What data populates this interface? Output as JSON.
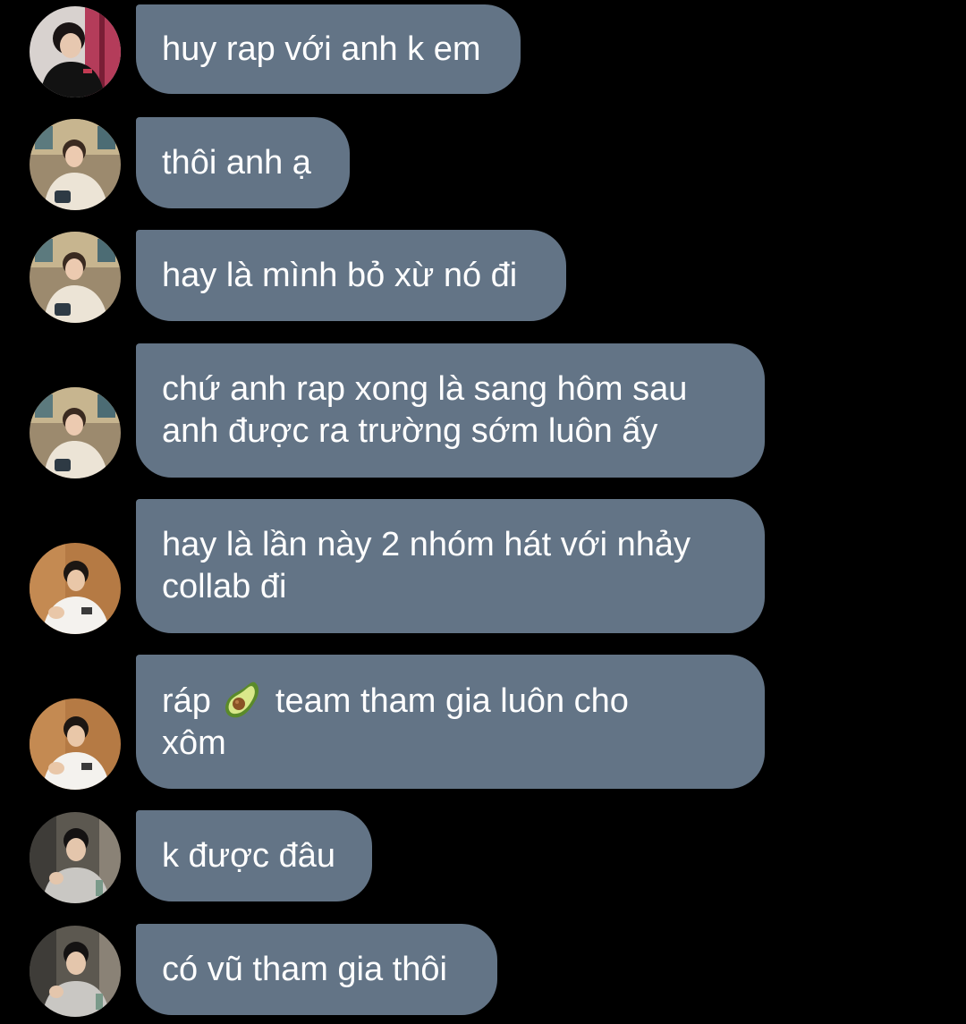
{
  "theme": {
    "background": "#000000",
    "bubble_color": "#637486",
    "text_color": "#ffffff"
  },
  "messages": [
    {
      "sender_avatar": "avatar-a",
      "text": "huy rap với anh k em"
    },
    {
      "sender_avatar": "avatar-b",
      "text": "thôi anh ạ"
    },
    {
      "sender_avatar": "avatar-b",
      "text": "hay là mình bỏ xừ nó đi"
    },
    {
      "sender_avatar": "avatar-b",
      "text": "chứ anh rap xong là sang hôm sau\nanh được ra trường sớm luôn ấy"
    },
    {
      "sender_avatar": "avatar-c",
      "text": "hay là lần này 2 nhóm hát với nhảy\ncollab đi"
    },
    {
      "sender_avatar": "avatar-c",
      "text_before_emoji": "ráp",
      "emoji": "avocado-icon",
      "text_after_emoji": "team tham gia luôn cho\nxôm"
    },
    {
      "sender_avatar": "avatar-d",
      "text": "k được đâu"
    },
    {
      "sender_avatar": "avatar-d",
      "text": "có vũ tham gia thôi"
    }
  ]
}
